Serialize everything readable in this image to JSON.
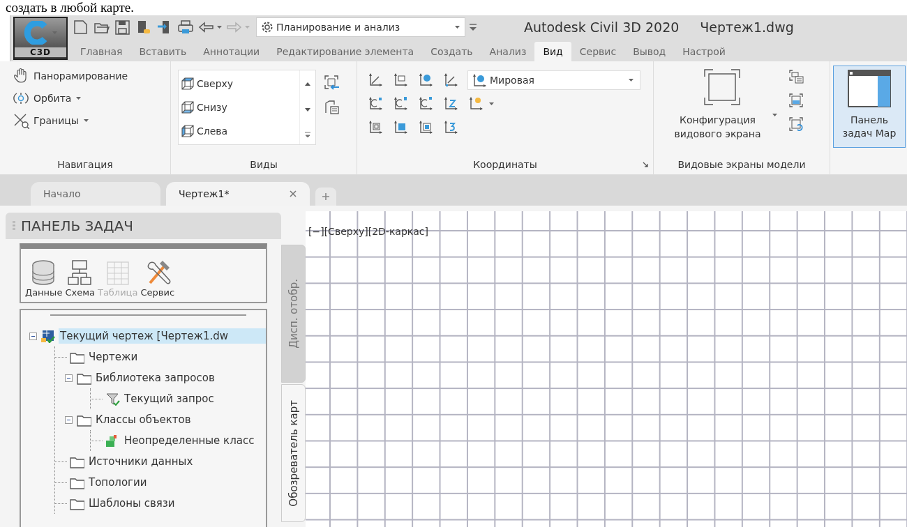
{
  "document_fragment": "создать в любой карте.",
  "app_button": {
    "label": "C3D"
  },
  "quick_access": {
    "buttons": [
      {
        "kind": "new",
        "disabled": false
      },
      {
        "kind": "open",
        "disabled": false
      },
      {
        "kind": "save",
        "disabled": false
      },
      {
        "kind": "saveas",
        "disabled": false
      },
      {
        "kind": "import",
        "disabled": false
      },
      {
        "kind": "print",
        "disabled": false
      },
      {
        "kind": "undo",
        "disabled": false
      },
      {
        "kind": "redo",
        "disabled": true
      }
    ],
    "workspace": "Планирование и анализ"
  },
  "window": {
    "app": "Autodesk Civil 3D 2020",
    "file": "Чертеж1.dwg"
  },
  "ribbon_tabs": [
    {
      "label": "Главная",
      "selected": false
    },
    {
      "label": "Вставить",
      "selected": false
    },
    {
      "label": "Аннотации",
      "selected": false
    },
    {
      "label": "Редактирование элемента",
      "selected": false
    },
    {
      "label": "Создать",
      "selected": false
    },
    {
      "label": "Анализ",
      "selected": false
    },
    {
      "label": "Вид",
      "selected": true
    },
    {
      "label": "Сервис",
      "selected": false
    },
    {
      "label": "Вывод",
      "selected": false
    },
    {
      "label": "Настрой",
      "selected": false
    }
  ],
  "ribbon": {
    "navigation": {
      "title": "Навигация",
      "items": [
        {
          "kind": "pan",
          "label": "Панорамирование",
          "dropdown": false
        },
        {
          "kind": "orbit",
          "label": "Орбита",
          "dropdown": true
        },
        {
          "kind": "extents",
          "label": "Границы",
          "dropdown": true
        }
      ]
    },
    "views": {
      "title": "Виды",
      "items": [
        {
          "kind": "top",
          "label": "Сверху"
        },
        {
          "kind": "bottom",
          "label": "Снизу"
        },
        {
          "kind": "left",
          "label": "Слева"
        }
      ]
    },
    "coordinates": {
      "title": "Координаты",
      "ucs": "Мировая"
    },
    "viewports": {
      "title": "Видовые экраны модели",
      "button": "Конфигурация видового экрана"
    },
    "map_panel_button": {
      "label": "Панель задач Map",
      "on": true
    }
  },
  "file_tabs": [
    {
      "label": "Начало",
      "selected": false,
      "closable": false
    },
    {
      "label": "Чертеж1*",
      "selected": true,
      "closable": true
    }
  ],
  "task_pane": {
    "title": "ПАНЕЛЬ ЗАДАЧ",
    "toolbar": [
      {
        "kind": "data",
        "label": "Данные",
        "disabled": false
      },
      {
        "kind": "schema",
        "label": "Схема",
        "disabled": false
      },
      {
        "kind": "table",
        "label": "Таблица",
        "disabled": true
      },
      {
        "kind": "tools",
        "label": "Сервис",
        "disabled": false
      }
    ],
    "tree": [
      {
        "label": "Текущий чертеж [Чертеж1.dw",
        "kind": "drawing",
        "selected": true,
        "expanded": true,
        "children": [
          {
            "label": "Чертежи",
            "kind": "folder",
            "selected": false
          },
          {
            "label": "Библиотека запросов",
            "kind": "folder",
            "selected": false,
            "expanded": true,
            "children": [
              {
                "label": "Текущий запрос",
                "kind": "query",
                "selected": false
              }
            ]
          },
          {
            "label": "Классы объектов",
            "kind": "folder",
            "selected": false,
            "expanded": true,
            "children": [
              {
                "label": "Неопределенные класс",
                "kind": "class",
                "selected": false
              }
            ]
          },
          {
            "label": "Источники данных",
            "kind": "folder",
            "selected": false
          },
          {
            "label": "Топологии",
            "kind": "folder",
            "selected": false
          },
          {
            "label": "Шаблоны связи",
            "kind": "folder",
            "selected": false
          }
        ]
      }
    ],
    "side_tabs": [
      {
        "label": "Дисп. отобр.",
        "selected": false
      },
      {
        "label": "Обозреватель карт",
        "selected": true
      }
    ]
  },
  "viewport": {
    "label": "[−][Сверху][2D-каркас]"
  }
}
